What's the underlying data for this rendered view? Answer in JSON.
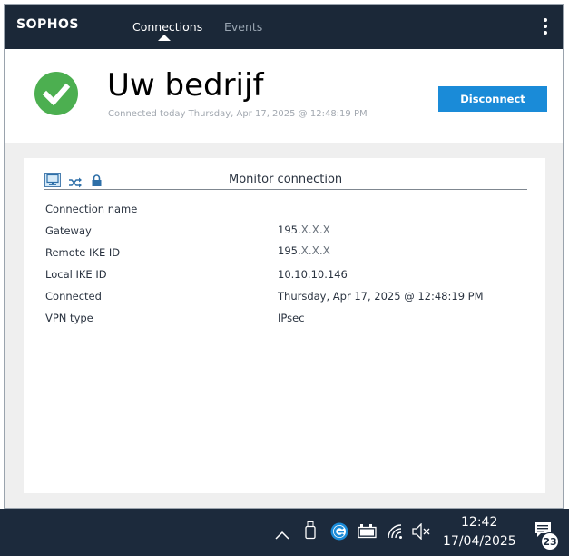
{
  "app": {
    "logo": "SOPHOS",
    "tabs": [
      {
        "label": "Connections",
        "active": true
      },
      {
        "label": "Events",
        "active": false
      }
    ]
  },
  "header": {
    "title": "Uw bedrijf",
    "connected_line": "Connected today Thursday, Apr 17, 2025 @ 12:48:19 PM",
    "disconnect_label": "Disconnect",
    "status_icon": "check-circle-icon",
    "status_color": "#4caf50",
    "accent": "#1a8bd8"
  },
  "monitor": {
    "title": "Monitor connection",
    "icons": [
      "monitor-icon",
      "shuffle-icon",
      "lock-icon"
    ],
    "rows": [
      {
        "label": "Connection name",
        "value": ""
      },
      {
        "label": "Gateway",
        "prefix": "195.",
        "masked": "X.X.X"
      },
      {
        "label": "Remote IKE ID",
        "prefix": "195.",
        "masked": "X.X.X"
      },
      {
        "label": "Local IKE ID",
        "value": "10.10.10.146"
      },
      {
        "label": "Connected",
        "value": "Thursday, Apr 17, 2025 @ 12:48:19 PM"
      },
      {
        "label": "VPN type",
        "value": "IPsec"
      }
    ]
  },
  "taskbar": {
    "time": "12:42",
    "date": "17/04/2025",
    "notification_count": "23",
    "tray_icons": [
      "chevron-up-icon",
      "usb-drive-icon",
      "vpn-client-icon",
      "battery-icon",
      "wifi-icon",
      "speaker-muted-icon",
      "notification-icon"
    ]
  }
}
